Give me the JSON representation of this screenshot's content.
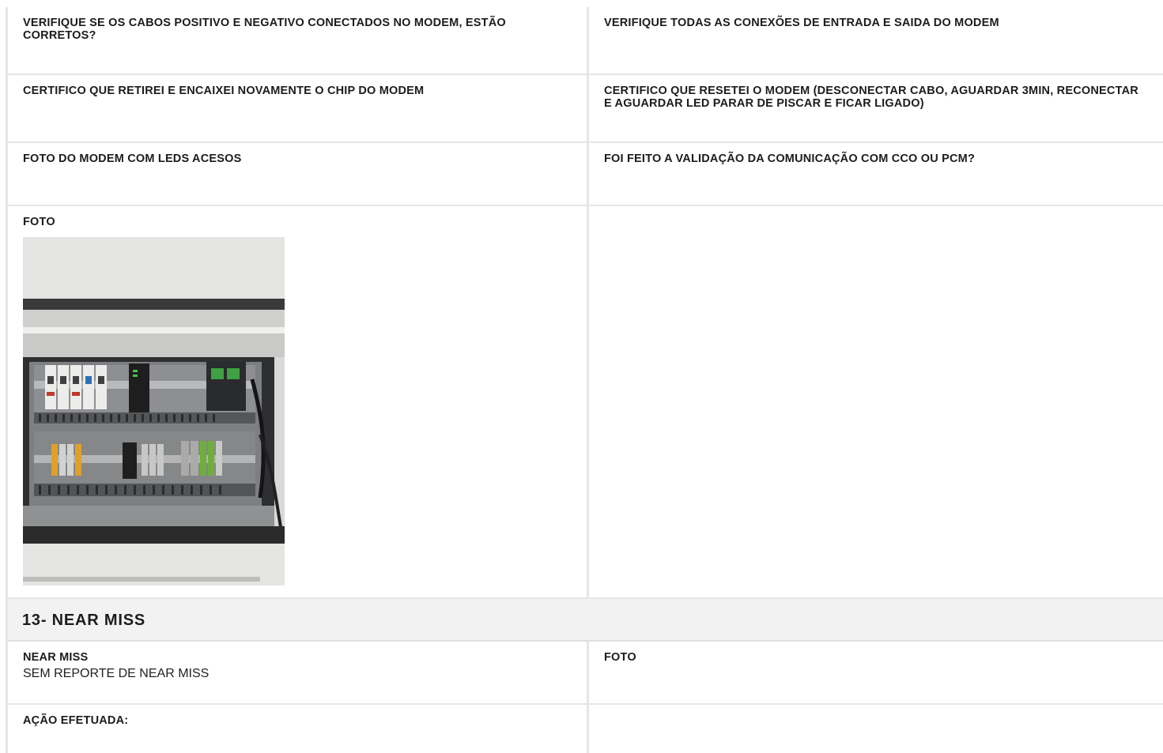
{
  "rows": [
    {
      "left": {
        "label": "VERIFIQUE SE OS CABOS POSITIVO E NEGATIVO CONECTADOS NO MODEM, ESTÃO CORRETOS?"
      },
      "right": {
        "label": "VERIFIQUE TODAS AS CONEXÕES DE ENTRADA E SAIDA DO MODEM"
      }
    },
    {
      "left": {
        "label": "CERTIFICO QUE RETIREI E ENCAIXEI NOVAMENTE O CHIP DO MODEM"
      },
      "right": {
        "label": "CERTIFICO QUE RESETEI O MODEM (DESCONECTAR CABO, AGUARDAR 3MIN, RECONECTAR E AGUARDAR LED PARAR DE PISCAR E FICAR LIGADO)"
      }
    },
    {
      "left": {
        "label": "FOTO DO MODEM COM LEDS ACESOS"
      },
      "right": {
        "label": "FOI FEITO A VALIDAÇÃO DA COMUNICAÇÃO COM CCO OU PCM?"
      }
    },
    {
      "left": {
        "label": "FOTO"
      },
      "right": {
        "label": ""
      }
    }
  ],
  "section": {
    "title": "13- NEAR MISS"
  },
  "near_miss": {
    "rows": [
      {
        "left": {
          "label": "NEAR MISS",
          "value": "SEM REPORTE DE NEAR MISS"
        },
        "right": {
          "label": "FOTO"
        }
      },
      {
        "left": {
          "label": "AÇÃO EFETUADA:"
        },
        "right": {
          "label": ""
        }
      }
    ]
  },
  "icons": {
    "photo": "electrical-panel-photo"
  }
}
